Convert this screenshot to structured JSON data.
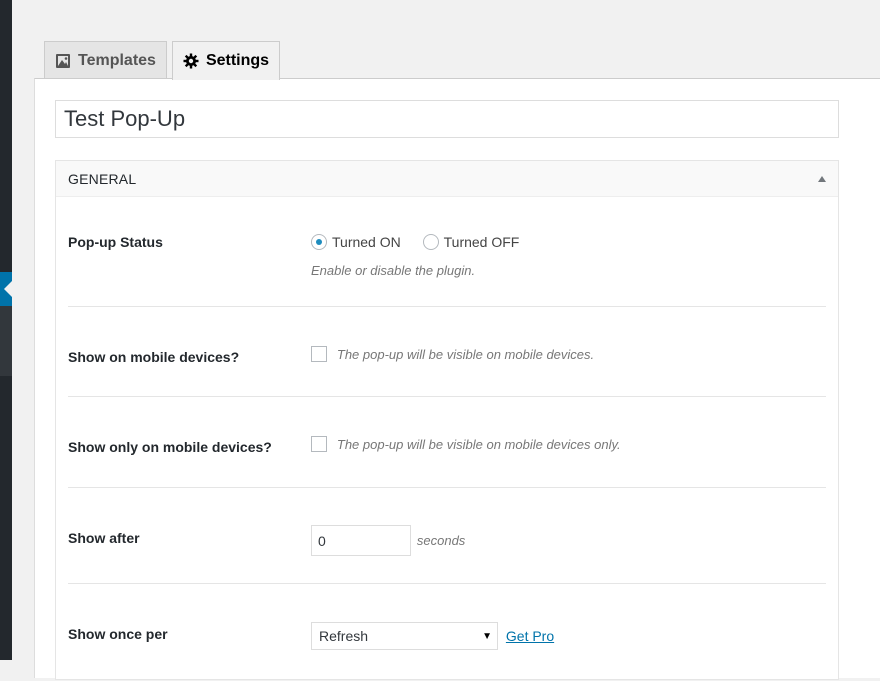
{
  "tabs": [
    {
      "label": "Templates",
      "icon": "image-icon"
    },
    {
      "label": "Settings",
      "icon": "gear-icon"
    }
  ],
  "title_value": "Test Pop-Up",
  "general": {
    "heading": "GENERAL",
    "popup_status": {
      "label": "Pop-up Status",
      "options": [
        "Turned ON",
        "Turned OFF"
      ],
      "selected": "Turned ON",
      "description": "Enable or disable the plugin."
    },
    "mobile": {
      "label": "Show on mobile devices?",
      "description": "The pop-up will be visible on mobile devices.",
      "checked": false
    },
    "mobile_only": {
      "label": "Show only on mobile devices?",
      "description": "The pop-up will be visible on mobile devices only.",
      "checked": false
    },
    "show_after": {
      "label": "Show after",
      "value": "0",
      "unit": "seconds"
    },
    "show_once": {
      "label": "Show once per",
      "selected": "Refresh",
      "link": "Get Pro"
    }
  },
  "colors": {
    "accent": "#0073aa",
    "radio": "#1e8cbe"
  }
}
